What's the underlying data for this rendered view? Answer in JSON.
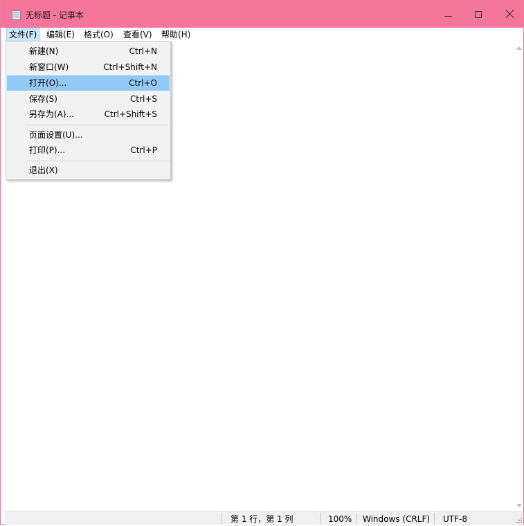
{
  "window": {
    "title": "无标题 - 记事本",
    "title_bar_color": "#f5769b",
    "app_icon": "notepad-icon",
    "controls": [
      "minimize-icon",
      "maximize-icon",
      "close-icon"
    ]
  },
  "menubar": {
    "items": [
      {
        "label": "文件(F)",
        "active": true
      },
      {
        "label": "编辑(E)"
      },
      {
        "label": "格式(O)"
      },
      {
        "label": "查看(V)"
      },
      {
        "label": "帮助(H)"
      }
    ]
  },
  "file_menu": {
    "highlight_color": "#91c9f7",
    "items": [
      {
        "label": "新建(N)",
        "shortcut": "Ctrl+N"
      },
      {
        "label": "新窗口(W)",
        "shortcut": "Ctrl+Shift+N"
      },
      {
        "label": "打开(O)...",
        "shortcut": "Ctrl+O",
        "highlighted": true
      },
      {
        "label": "保存(S)",
        "shortcut": "Ctrl+S"
      },
      {
        "label": "另存为(A)...",
        "shortcut": "Ctrl+Shift+S"
      },
      {
        "label": "页面设置(U)..."
      },
      {
        "label": "打印(P)...",
        "shortcut": "Ctrl+P"
      },
      {
        "label": "退出(X)"
      }
    ]
  },
  "editor": {
    "content": ""
  },
  "statusbar": {
    "position": "第 1 行，第 1 列",
    "zoom": "100%",
    "line_ending": "Windows (CRLF)",
    "encoding": "UTF-8"
  }
}
